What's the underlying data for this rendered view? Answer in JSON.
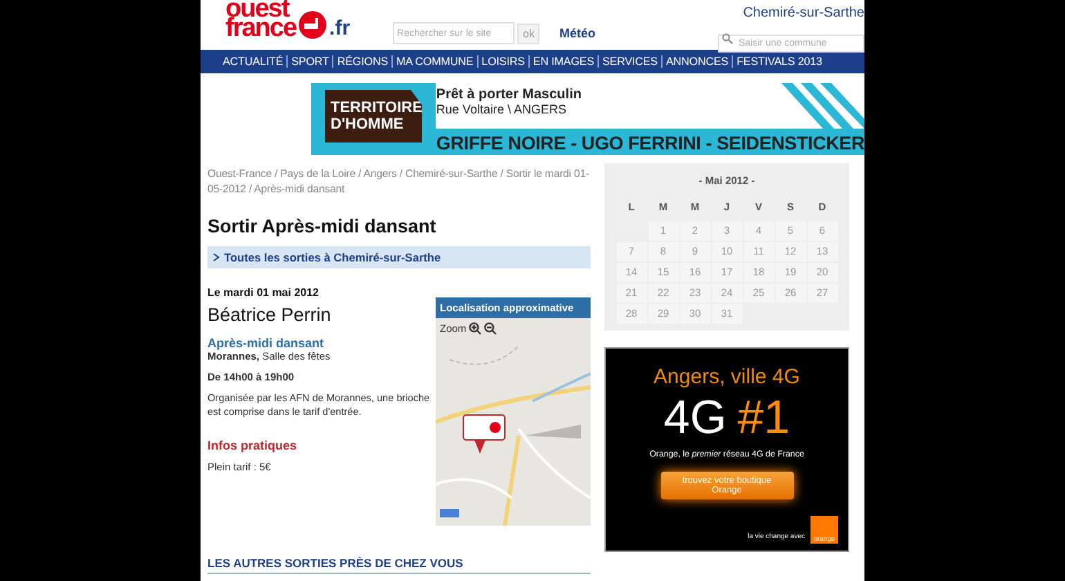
{
  "header": {
    "logo": {
      "line1": "ouest",
      "line2": "france",
      "suffix": ".fr"
    },
    "search": {
      "placeholder": "Rechercher sur le site",
      "button": "ok"
    },
    "weather_link": "Météo",
    "town": "Chemiré-sur-Sarthe",
    "commune_search": {
      "placeholder": "Saisir une commune"
    }
  },
  "nav": [
    {
      "label": "ACTUALITÉ"
    },
    {
      "label": "SPORT"
    },
    {
      "label": "RÉGIONS"
    },
    {
      "label": "MA COMMUNE"
    },
    {
      "label": "LOISIRS"
    },
    {
      "label": "EN IMAGES"
    },
    {
      "label": "SERVICES"
    },
    {
      "label": "ANNONCES"
    },
    {
      "label": "FESTIVALS 2013"
    }
  ],
  "banner": {
    "brand_line1": "TERRITOIRE",
    "brand_line2": "D'HOMME",
    "title": "Prêt à porter Masculin",
    "address": "Rue Voltaire \\ ANGERS",
    "brands": "GRIFFE NOIRE - UGO FERRINI - SEIDENSTICKER"
  },
  "breadcrumb": "Ouest-France / Pays de la Loire / Angers / Chemiré-sur-Sarthe / Sortir le mardi 01-05-2012 / Après-midi dansant",
  "article": {
    "heading": "Sortir Après-midi dansant",
    "all_link": "Toutes les sorties à Chemiré-sur-Sarthe",
    "date": "Le mardi 01 mai 2012",
    "organizer": "Béatrice Perrin",
    "event_title": "Après-midi dansant",
    "place_town": "Morannes,",
    "place_venue": "Salle des fêtes",
    "hours": "De 14h00 à 19h00",
    "description": "Organisée par les AFN de Morannes, une brioche est comprise dans le tarif d'entrée.",
    "info_heading": "Infos pratiques",
    "price": "Plein tarif : 5€",
    "more_heading": "LES AUTRES SORTIES PRÈS DE CHEZ VOUS"
  },
  "map": {
    "title": "Localisation approximative",
    "zoom_label": "Zoom"
  },
  "calendar": {
    "title": "- Mai 2012 -",
    "weekdays": [
      "L",
      "M",
      "M",
      "J",
      "V",
      "S",
      "D"
    ],
    "weeks": [
      [
        "1",
        "2",
        "3",
        "4",
        "5",
        "6"
      ],
      [
        "7",
        "8",
        "9",
        "10",
        "11",
        "12",
        "13"
      ],
      [
        "14",
        "15",
        "16",
        "17",
        "18",
        "19",
        "20"
      ],
      [
        "21",
        "22",
        "23",
        "24",
        "25",
        "26",
        "27"
      ],
      [
        "28",
        "29",
        "30",
        "31"
      ]
    ]
  },
  "ad": {
    "headline": "Angers, ville 4G",
    "big_left": "4G",
    "big_right": "#1",
    "tagline": "Orange, le *premier* réseau 4G de France",
    "button": "trouvez votre boutique Orange",
    "slogan": "la vie change avec",
    "brand": "orange"
  }
}
